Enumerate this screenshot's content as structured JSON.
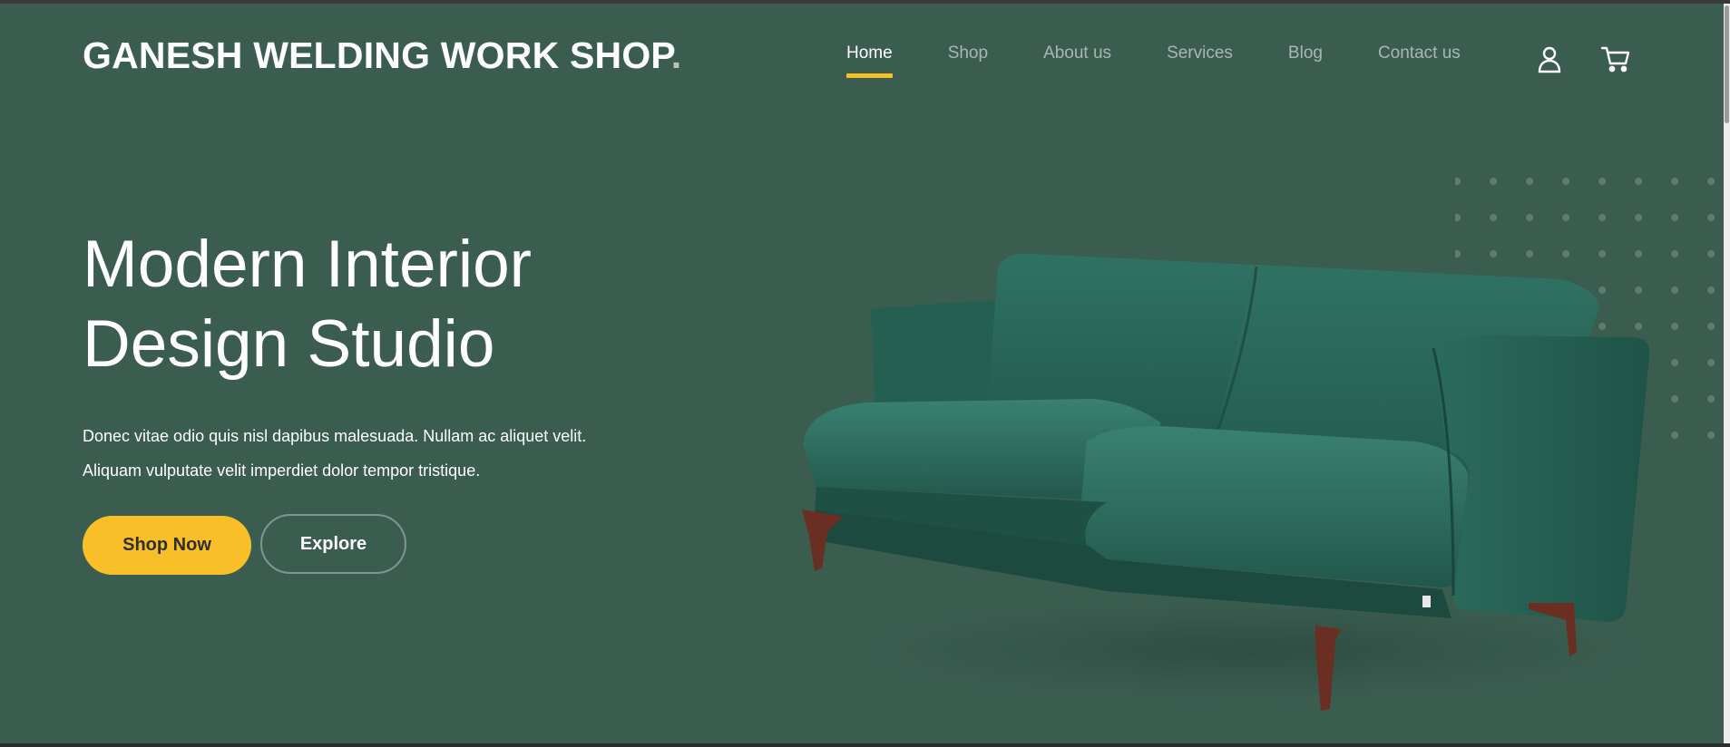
{
  "brand": {
    "name": "GANESH WELDING WORK SHOP",
    "dot": "."
  },
  "nav": {
    "items": [
      {
        "label": "Home",
        "active": true
      },
      {
        "label": "Shop",
        "active": false
      },
      {
        "label": "About us",
        "active": false
      },
      {
        "label": "Services",
        "active": false
      },
      {
        "label": "Blog",
        "active": false
      },
      {
        "label": "Contact us",
        "active": false
      }
    ],
    "icons": [
      "user-icon",
      "cart-icon"
    ]
  },
  "hero": {
    "title_line1": "Modern Interior",
    "title_line2": "Design Studio",
    "desc_line1": "Donec vitae odio quis nisl dapibus malesuada. Nullam ac aliquet velit.",
    "desc_line2": "Aliquam vulputate velit imperdiet dolor tempor tristique.",
    "primary_button": "Shop Now",
    "secondary_button": "Explore",
    "image": "green-velvet-sofa"
  },
  "colors": {
    "background": "#3b5d50",
    "accent": "#f9bf29",
    "text": "#ffffff",
    "sofa": "#2e6a5c",
    "legs": "#6b2e22"
  }
}
